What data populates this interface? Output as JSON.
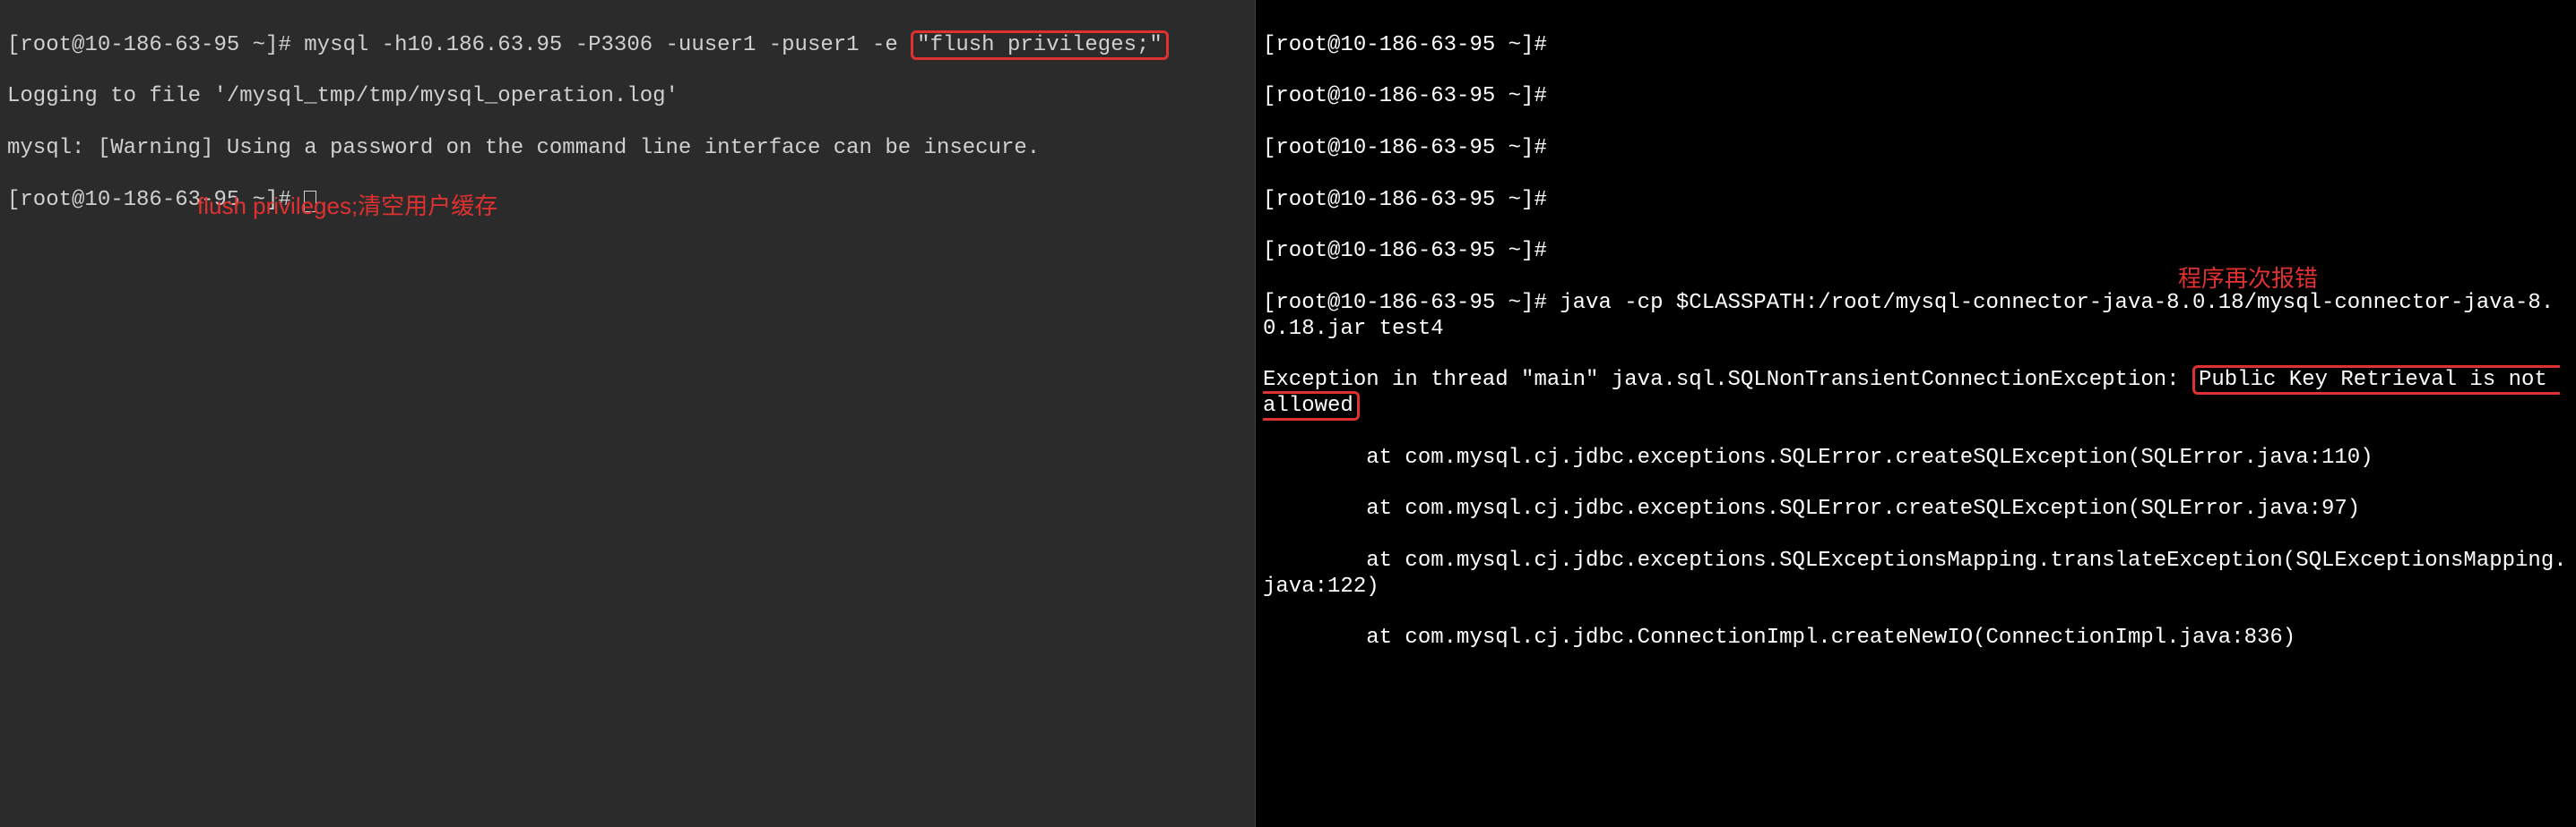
{
  "left": {
    "prompt": "[root@10-186-63-95 ~]#",
    "cmd_part1": " mysql -h10.186.63.95 -P3306 -uuser1 -puser1 -e ",
    "cmd_highlighted": "\"flush privileges;\"",
    "log1": "Logging to file '/mysql_tmp/tmp/mysql_operation.log'",
    "log2": "mysql: [Warning] Using a password on the command line interface can be insecure.",
    "prompt2": "[root@10-186-63-95 ~]# ",
    "annotation": "flush privileges;清空用户缓存"
  },
  "right": {
    "p1": "[root@10-186-63-95 ~]#",
    "p2": "[root@10-186-63-95 ~]#",
    "p3": "[root@10-186-63-95 ~]#",
    "p4": "[root@10-186-63-95 ~]#",
    "p5": "[root@10-186-63-95 ~]#",
    "cmd_line": "[root@10-186-63-95 ~]# java -cp $CLASSPATH:/root/mysql-connector-java-8.0.18/mysql-connector-java-8.0.18.jar test4",
    "exc_part1": "Exception in thread \"main\" java.sql.SQLNonTransientConnectionException: ",
    "exc_highlighted": "Public Key Retrieval is not allowed",
    "trace1": "        at com.mysql.cj.jdbc.exceptions.SQLError.createSQLException(SQLError.java:110)",
    "trace2": "        at com.mysql.cj.jdbc.exceptions.SQLError.createSQLException(SQLError.java:97)",
    "trace3": "        at com.mysql.cj.jdbc.exceptions.SQLExceptionsMapping.translateException(SQLExceptionsMapping.java:122)",
    "trace4": "        at com.mysql.cj.jdbc.ConnectionImpl.createNewIO(ConnectionImpl.java:836)",
    "annotation": "程序再次报错"
  }
}
